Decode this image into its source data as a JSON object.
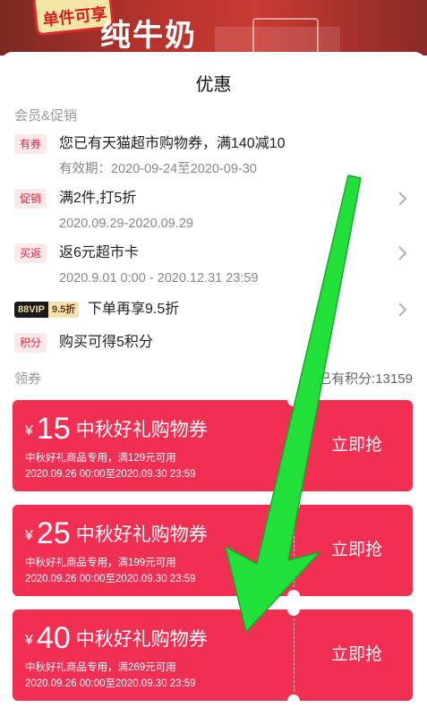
{
  "background": {
    "stamp_text": "单件可享",
    "product_text": "纯牛奶"
  },
  "title": "优惠",
  "promo_section_label": "会员&促销",
  "promotions": [
    {
      "tag": "有券",
      "main": "您已有天猫超市购物券，满140减10",
      "sub": "有效期：2020-09-24至2020-09-30",
      "has_chevron": false
    },
    {
      "tag": "促销",
      "main": "满2件,打5折",
      "sub": "2020.09.29-2020.09.29",
      "has_chevron": true
    },
    {
      "tag": "买返",
      "main": "返6元超市卡",
      "sub": "2020.9.01 0:00 - 2020.12.31 23:59",
      "has_chevron": true
    }
  ],
  "vip_row": {
    "badge_left": "88VIP",
    "badge_right": "9.5折",
    "main": "下单再享9.5折"
  },
  "points_row": {
    "tag": "积分",
    "main": "购买可得5积分"
  },
  "coupon_section_label": "领券",
  "points_balance": "已有积分:13159",
  "coupons": [
    {
      "currency": "¥",
      "amount": "15",
      "name": "中秋好礼购物券",
      "condition": "中秋好礼商品专用，满129元可用",
      "validity": "2020.09.26 00:00至2020.09.30 23:59",
      "button": "立即抢"
    },
    {
      "currency": "¥",
      "amount": "25",
      "name": "中秋好礼购物券",
      "condition": "中秋好礼商品专用，满199元可用",
      "validity": "2020.09.26 00:00至2020.09.30 23:59",
      "button": "立即抢"
    },
    {
      "currency": "¥",
      "amount": "40",
      "name": "中秋好礼购物券",
      "condition": "中秋好礼商品专用，满269元可用",
      "validity": "2020.09.26 00:00至2020.09.30 23:59",
      "button": "立即抢"
    }
  ],
  "colors": {
    "coupon_red": "#f12f53",
    "tag_red": "#e1243f",
    "arrow_green": "#22e03a"
  },
  "icons": {
    "row_chevron": "chevron-right-icon"
  }
}
